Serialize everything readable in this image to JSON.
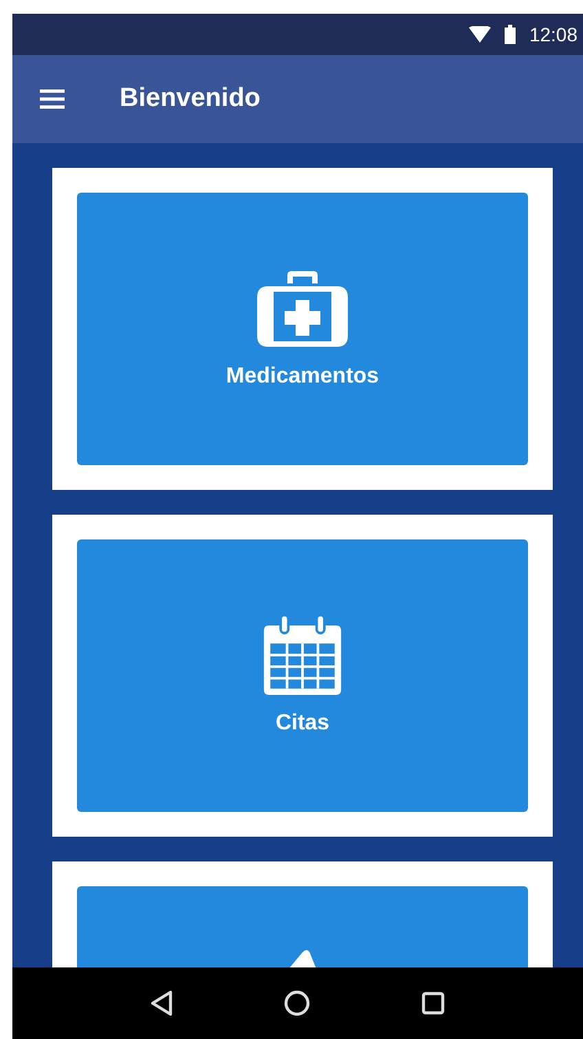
{
  "status_bar": {
    "time": "12:08"
  },
  "app_bar": {
    "title": "Bienvenido"
  },
  "cards": [
    {
      "kind": "medkit",
      "label": "Medicamentos"
    },
    {
      "kind": "calendar",
      "label": "Citas"
    },
    {
      "kind": "partial"
    }
  ]
}
